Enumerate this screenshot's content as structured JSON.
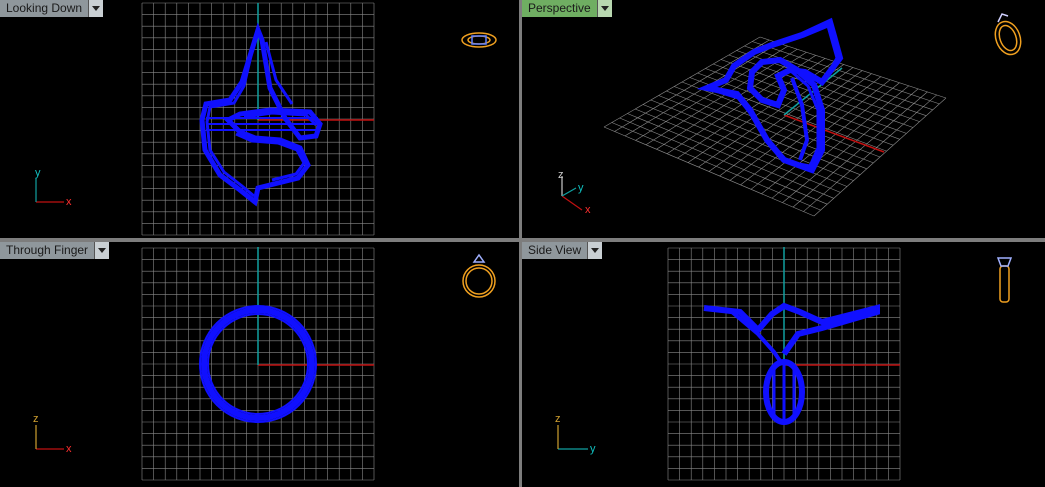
{
  "viewports": {
    "top_left": {
      "title": "Looking Down",
      "axis_h": "x",
      "axis_v": "y"
    },
    "top_right": {
      "title": "Perspective",
      "axis_z": "z",
      "axis_y": "y",
      "axis_x": "x"
    },
    "bottom_left": {
      "title": "Through Finger",
      "axis_h": "x",
      "axis_v": "z"
    },
    "bottom_right": {
      "title": "Side View",
      "axis_h": "y",
      "axis_v": "z"
    }
  },
  "colors": {
    "grid": "#8a8a8a",
    "model": "#1010ff",
    "axis_red": "#c01010",
    "axis_cyan": "#10a0a0",
    "icon": "#f0a020",
    "active_tab": "#6fae62"
  },
  "icons": [
    "ring-top-icon",
    "ring-perspective-icon",
    "ring-front-icon",
    "ring-side-icon"
  ]
}
